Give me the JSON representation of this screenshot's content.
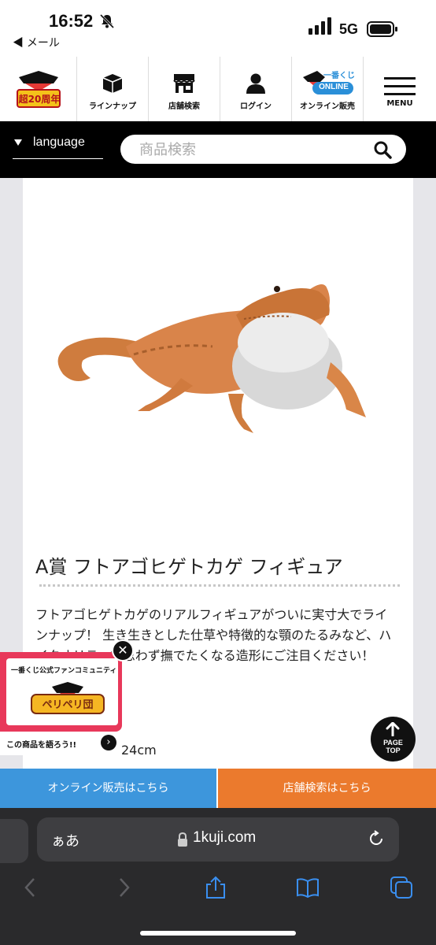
{
  "status_bar": {
    "time": "16:52",
    "back_app": "◀ メール",
    "network": "5G"
  },
  "header": {
    "logo_text": "超20周年",
    "logo_top": "一番くじ",
    "nav": [
      {
        "label": "ラインナップ",
        "icon": "box-icon"
      },
      {
        "label": "店舗検索",
        "icon": "store-icon"
      },
      {
        "label": "ログイン",
        "icon": "user-icon"
      },
      {
        "label": "オンライン販売",
        "icon": "online-logo-icon",
        "logo_top": "一番くじ",
        "logo_main": "ONLINE"
      },
      {
        "label": "MENU",
        "icon": "hamburger-icon"
      }
    ]
  },
  "search": {
    "language_label": "language",
    "placeholder": "商品検索"
  },
  "product": {
    "title": "A賞 フトアゴヒゲトカゲ フィギュア",
    "description": "フトアゴヒゲトカゲのリアルフィギュアがついに実寸大でラインナップ！ 生き生きとした仕草や特徴的な顎のたるみなど、ハイクオリティで思わず撫でたくなる造形にご注目ください！",
    "size_fragment": "24cm"
  },
  "community_banner": {
    "top_text": "一番くじ公式ファンコミュニティ",
    "logo_main": "ペリペリ団",
    "caption": "この商品を語ろう!!",
    "close": "✕",
    "arrow": "›"
  },
  "page_top": {
    "label_line1": "PAGE",
    "label_line2": "TOP"
  },
  "cta": {
    "online": "オンライン販売はこちら",
    "store": "店舗検索はこちら"
  },
  "browser": {
    "aa": "ぁあ",
    "url": "1kuji.com"
  },
  "colors": {
    "online_button": "#3d96dc",
    "store_button": "#eb7a2d",
    "community_pink": "#e8385a",
    "header_black": "#000000"
  }
}
